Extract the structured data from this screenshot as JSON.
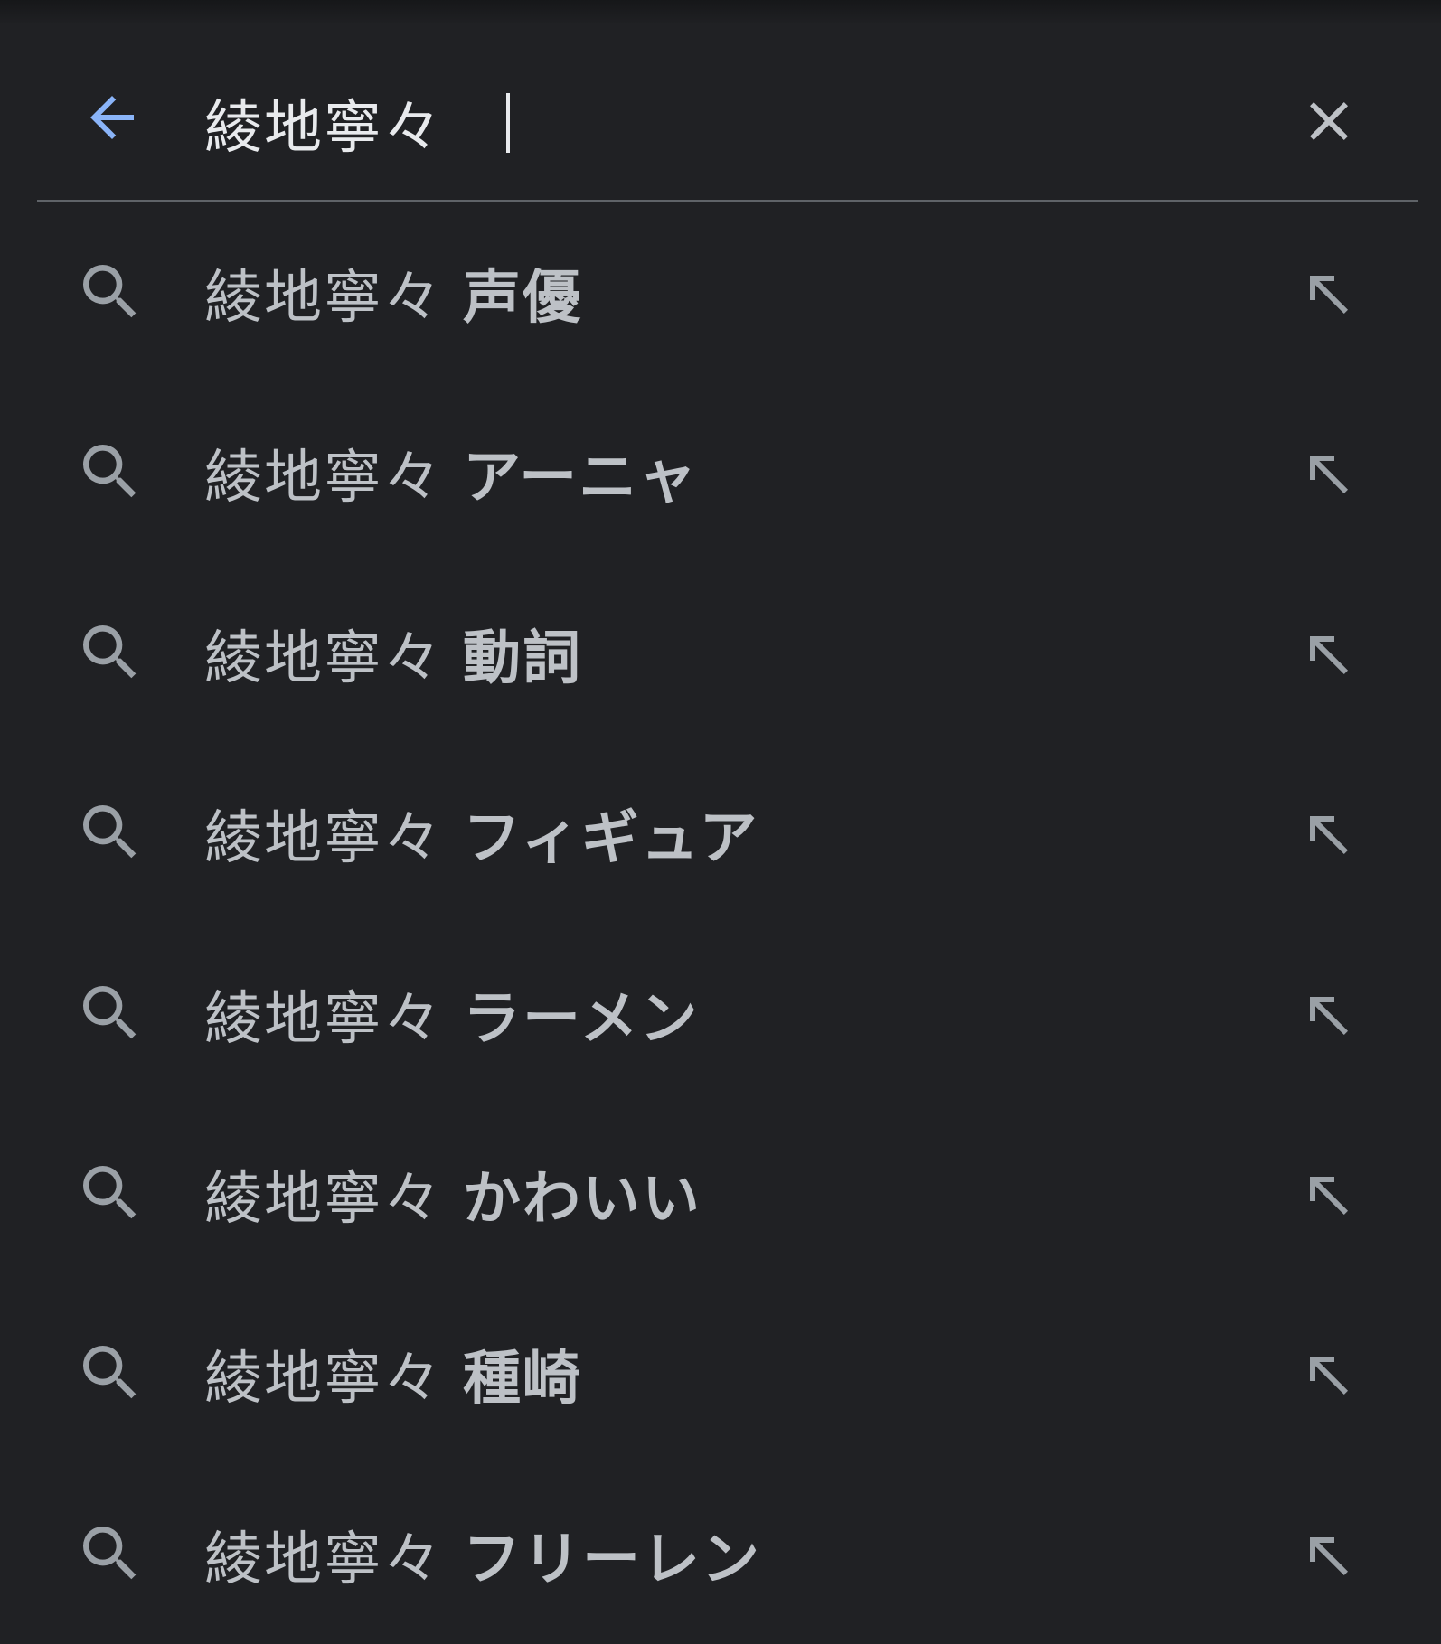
{
  "search": {
    "query": "綾地寧々",
    "back_icon": "arrow-back-icon",
    "clear_icon": "close-icon",
    "accent_color": "#8ab4f8"
  },
  "suggestions": [
    {
      "prefix": "綾地寧々",
      "completion": "声優"
    },
    {
      "prefix": "綾地寧々",
      "completion": "アーニャ"
    },
    {
      "prefix": "綾地寧々",
      "completion": "動詞"
    },
    {
      "prefix": "綾地寧々",
      "completion": "フィギュア"
    },
    {
      "prefix": "綾地寧々",
      "completion": "ラーメン"
    },
    {
      "prefix": "綾地寧々",
      "completion": "かわいい"
    },
    {
      "prefix": "綾地寧々",
      "completion": "種崎"
    },
    {
      "prefix": "綾地寧々",
      "completion": "フリーレン"
    }
  ],
  "icons": {
    "row_left": "search-icon",
    "row_right": "arrow-up-left-icon"
  },
  "colors": {
    "background": "#202124",
    "text": "#bdc1c6",
    "icon": "#9aa0a6"
  }
}
